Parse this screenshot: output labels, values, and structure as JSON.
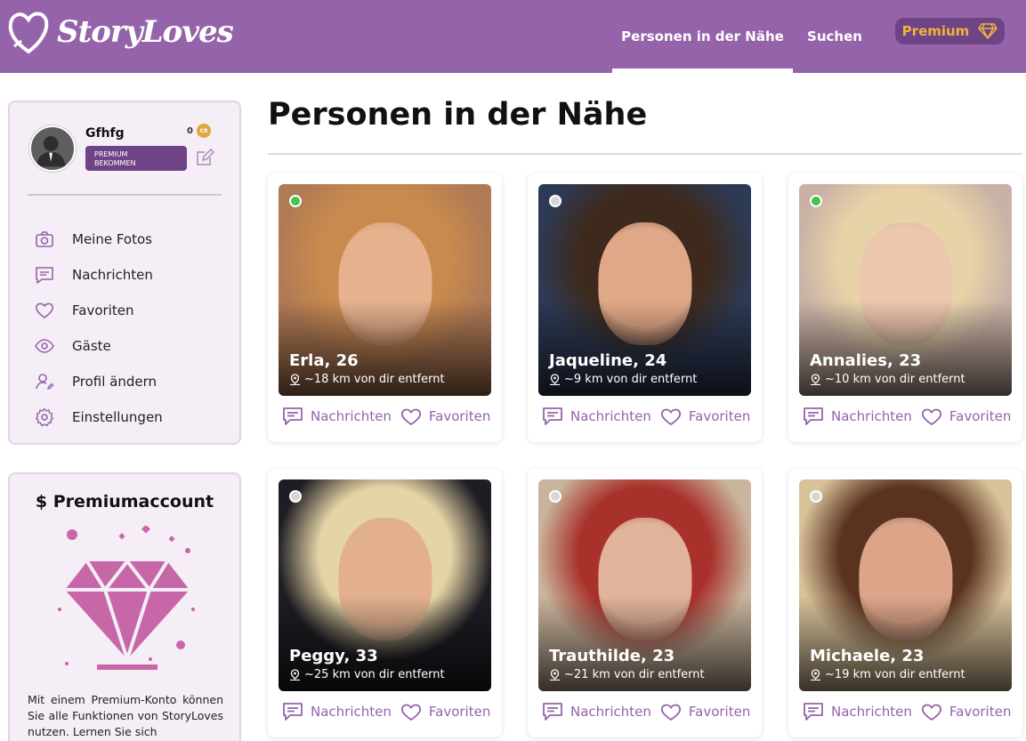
{
  "brand": {
    "name": "StoryLoves"
  },
  "nav": {
    "nearby": "Personen in der Nähe",
    "search": "Suchen",
    "premium": "Premium"
  },
  "profile": {
    "username": "Gfhfg",
    "credits": "0",
    "credit_unit": "CR",
    "premium_line1": "PREMIUM",
    "premium_line2": "BEKOMMEN"
  },
  "menu": [
    {
      "label": "Meine Fotos",
      "icon": "camera-icon"
    },
    {
      "label": "Nachrichten",
      "icon": "message-icon"
    },
    {
      "label": "Favoriten",
      "icon": "heart-icon"
    },
    {
      "label": "Gäste",
      "icon": "eye-icon"
    },
    {
      "label": "Profil ändern",
      "icon": "user-edit-icon"
    },
    {
      "label": "Einstellungen",
      "icon": "gear-icon"
    }
  ],
  "premium_box": {
    "title": "$ Premiumaccount",
    "text": "Mit einem Premium-Konto können Sie alle Funktionen von StoryLoves nutzen. Lernen Sie sich"
  },
  "main": {
    "title": "Personen in der Nähe"
  },
  "labels": {
    "messages": "Nachrichten",
    "favorites": "Favoriten"
  },
  "profiles": [
    {
      "name": "Erla, 26",
      "distance": "~18 km von dir entfernt",
      "online": true,
      "hair": "#c98a4e",
      "skin": "#e6b18d",
      "bg": "#b07a55"
    },
    {
      "name": "Jaqueline, 24",
      "distance": "~9 km von dir entfernt",
      "online": false,
      "hair": "#3d2a1d",
      "skin": "#e0a888",
      "bg": "#2d3a55"
    },
    {
      "name": "Annalies, 23",
      "distance": "~10 km von dir entfernt",
      "online": true,
      "hair": "#e8d3a8",
      "skin": "#ecc6ad",
      "bg": "#c9b2a5"
    },
    {
      "name": "Peggy, 33",
      "distance": "~25 km von dir entfernt",
      "online": false,
      "hair": "#e5d4a6",
      "skin": "#e2b08f",
      "bg": "#1f1d24"
    },
    {
      "name": "Trauthilde, 23",
      "distance": "~21 km von dir entfernt",
      "online": false,
      "hair": "#a8312b",
      "skin": "#e0b49a",
      "bg": "#c9b59d"
    },
    {
      "name": "Michaele, 23",
      "distance": "~19 km von dir entfernt",
      "online": false,
      "hair": "#5a3320",
      "skin": "#dca58a",
      "bg": "#d8c29a"
    }
  ],
  "colors": {
    "brand": "#9563aa",
    "brand_dark": "#6f4486",
    "gold": "#f2b33d",
    "online": "#45c447",
    "diamond": "#c767a8"
  }
}
